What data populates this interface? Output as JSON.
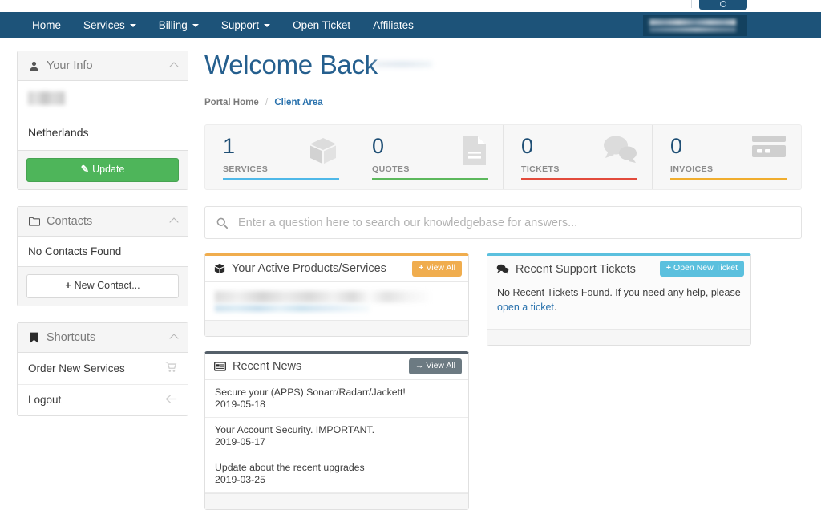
{
  "topbar": {
    "cut_button_icon": "user-circle-icon"
  },
  "navbar": {
    "items": [
      {
        "label": "Home",
        "has_caret": false
      },
      {
        "label": "Services",
        "has_caret": true
      },
      {
        "label": "Billing",
        "has_caret": true
      },
      {
        "label": "Support",
        "has_caret": true
      },
      {
        "label": "Open Ticket",
        "has_caret": false
      },
      {
        "label": "Affiliates",
        "has_caret": false
      }
    ],
    "user_menu_label": "",
    "background_color": "#1d5379"
  },
  "sidebar": {
    "your_info": {
      "title": "Your Info",
      "icon": "user-icon",
      "name": "",
      "country": "Netherlands",
      "update_label": "Update",
      "update_icon": "pencil-icon",
      "update_color": "#4eb55a"
    },
    "contacts": {
      "title": "Contacts",
      "icon": "folder-icon",
      "empty_text": "No Contacts Found",
      "new_contact_label": "New Contact..."
    },
    "shortcuts": {
      "title": "Shortcuts",
      "icon": "bookmark-icon",
      "items": [
        {
          "label": "Order New Services",
          "icon": "cart-icon"
        },
        {
          "label": "Logout",
          "icon": "arrow-left-icon"
        }
      ]
    }
  },
  "main": {
    "page_title": "Welcome Back",
    "title_color": "#255f8e",
    "breadcrumb": {
      "home_label": "Portal Home",
      "separator": "/",
      "current_label": "Client Area"
    },
    "stats": [
      {
        "value": "1",
        "label": "SERVICES",
        "icon": "box-icon",
        "bar_color": "#4fb8e8"
      },
      {
        "value": "0",
        "label": "QUOTES",
        "icon": "document-icon",
        "bar_color": "#5cb85c"
      },
      {
        "value": "0",
        "label": "TICKETS",
        "icon": "chat-icon",
        "bar_color": "#e24b3c"
      },
      {
        "value": "0",
        "label": "INVOICES",
        "icon": "credit-card-icon",
        "bar_color": "#f0ad2e"
      }
    ],
    "search": {
      "placeholder": "Enter a question here to search our knowledgebase for answers...",
      "value": "",
      "icon": "search-icon"
    },
    "products_card": {
      "title": "Your Active Products/Services",
      "icon": "box-icon",
      "action_label": "View All",
      "action_prefix": "+",
      "action_color": "#f0ad4e",
      "accent_color": "#f0ad4e"
    },
    "tickets_card": {
      "title": "Recent Support Tickets",
      "icon": "chat-icon",
      "action_label": "Open New Ticket",
      "action_prefix": "+",
      "action_color": "#5bc0de",
      "accent_color": "#5bc0de",
      "empty_text_before": "No Recent Tickets Found. If you need any help, please ",
      "empty_link_text": "open a ticket",
      "empty_text_after": "."
    },
    "news_card": {
      "title": "Recent News",
      "icon": "newspaper-icon",
      "action_label": "View All",
      "action_prefix": "→",
      "action_color": "#6c7a82",
      "accent_color": "#55606a",
      "items": [
        {
          "title": "Secure your (APPS) Sonarr/Radarr/Jackett!",
          "date": "2019-05-18"
        },
        {
          "title": "Your Account Security. IMPORTANT.",
          "date": "2019-05-17"
        },
        {
          "title": "Update about the recent upgrades",
          "date": "2019-03-25"
        }
      ]
    }
  }
}
